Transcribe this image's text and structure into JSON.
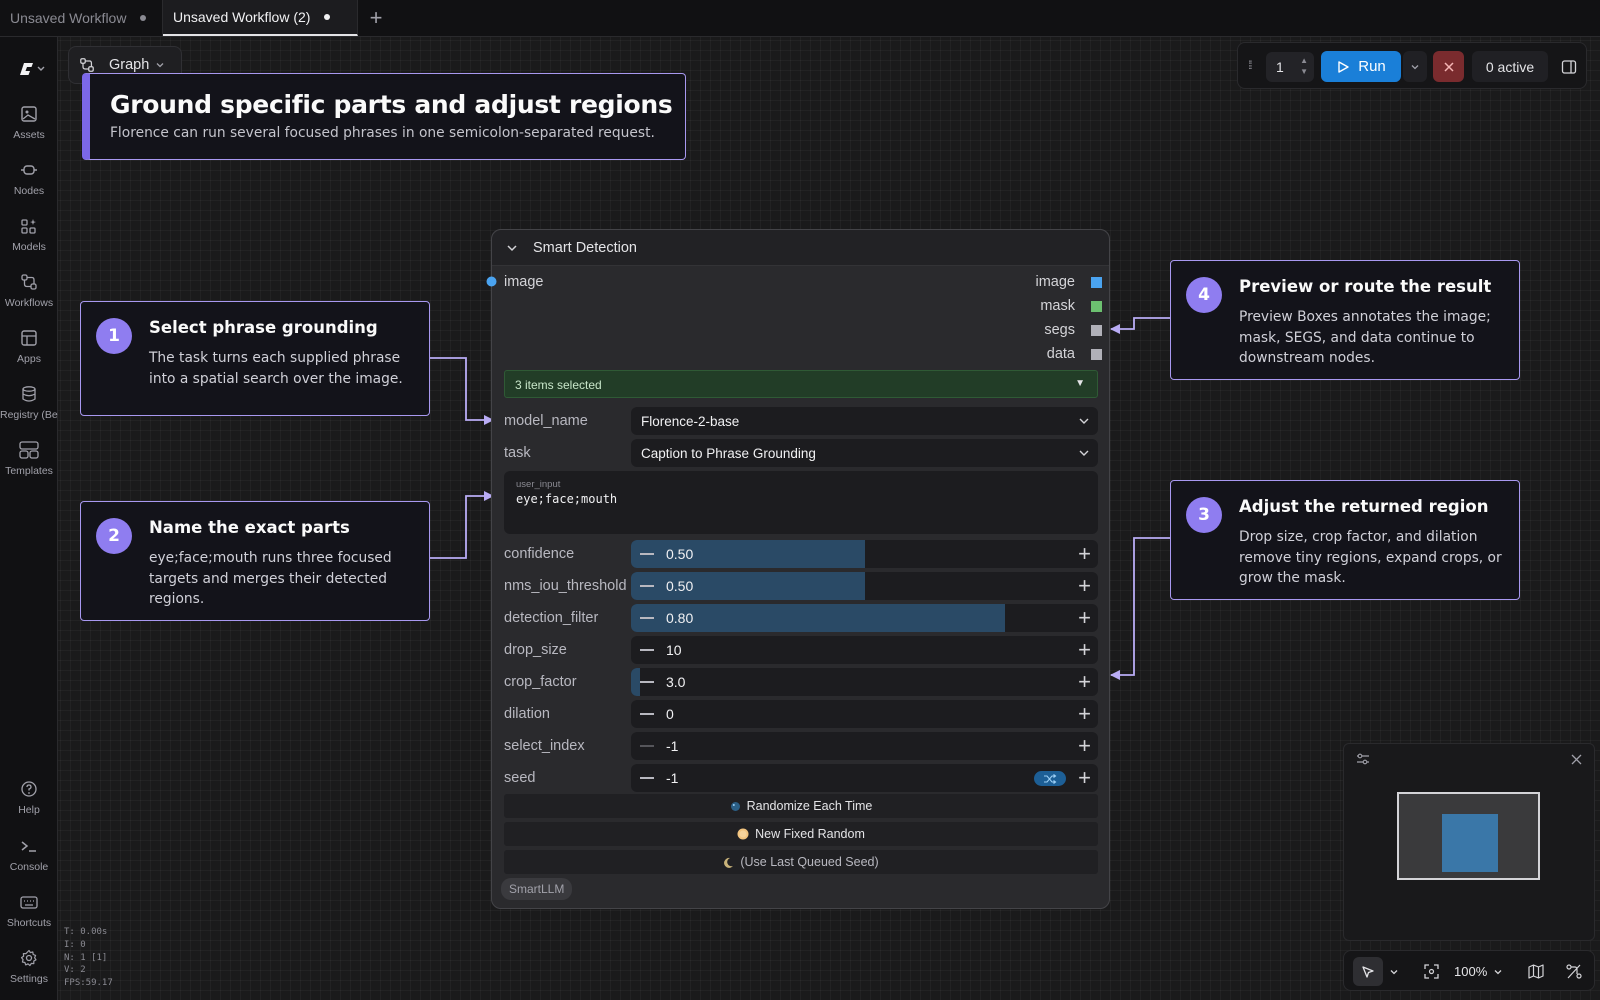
{
  "tabs": [
    {
      "label": "Unsaved Workflow",
      "active": false
    },
    {
      "label": "Unsaved Workflow (2)",
      "active": true
    }
  ],
  "sidebar": {
    "items": [
      {
        "label": "Assets",
        "icon": "image-icon"
      },
      {
        "label": "Nodes",
        "icon": "node-icon"
      },
      {
        "label": "Models",
        "icon": "models-icon"
      },
      {
        "label": "Workflows",
        "icon": "workflow-icon"
      },
      {
        "label": "Apps",
        "icon": "apps-icon"
      },
      {
        "label": "Registry (Beta)",
        "icon": "database-icon"
      },
      {
        "label": "Templates",
        "icon": "templates-icon"
      }
    ],
    "bottom_items": [
      {
        "label": "Help",
        "icon": "help-icon"
      },
      {
        "label": "Console",
        "icon": "terminal-icon"
      },
      {
        "label": "Shortcuts",
        "icon": "keyboard-icon"
      },
      {
        "label": "Settings",
        "icon": "gear-icon"
      }
    ]
  },
  "stats": [
    "T: 0.00s",
    "I: 0",
    "N: 1 [1]",
    "V: 2",
    "FPS:59.17"
  ],
  "graph_button": {
    "label": "Graph"
  },
  "runbar": {
    "count": "1",
    "run_label": "Run",
    "active_label": "0 active",
    "run_color": "#1a7fd8",
    "stop_color": "#7a2b2e"
  },
  "title_card": {
    "title": "Ground specific parts and adjust regions",
    "subtitle": "Florence can run several focused phrases in one semicolon-separated request."
  },
  "steps": [
    {
      "number": "1",
      "title": "Select phrase grounding",
      "body": "The task turns each supplied phrase into a spatial search over the image."
    },
    {
      "number": "2",
      "title": "Name the exact parts",
      "body": "eye;face;mouth runs three focused targets and merges their detected regions."
    },
    {
      "number": "3",
      "title": "Adjust the returned region",
      "body": "Drop size, crop factor, and dilation remove tiny regions, expand crops, or grow the mask."
    },
    {
      "number": "4",
      "title": "Preview or route the result",
      "body": "Preview Boxes annotates the image; mask, SEGS, and data continue to downstream nodes."
    }
  ],
  "node": {
    "title": "Smart Detection",
    "input": "image",
    "outputs": [
      {
        "label": "image",
        "color": "#4aa3f0"
      },
      {
        "label": "mask",
        "color": "#6cc070"
      },
      {
        "label": "segs",
        "color": "#b0b0b8"
      },
      {
        "label": "data",
        "color": "#b0b0b8"
      }
    ],
    "multiselect": "3 items selected",
    "model_name": {
      "label": "model_name",
      "value": "Florence-2-base"
    },
    "task": {
      "label": "task",
      "value": "Caption to Phrase Grounding"
    },
    "user_input": {
      "label": "user_input",
      "value": "eye;face;mouth"
    },
    "widgets": [
      {
        "label": "confidence",
        "value": "0.50",
        "fill": 0.5
      },
      {
        "label": "nms_iou_threshold",
        "value": "0.50",
        "fill": 0.5
      },
      {
        "label": "detection_filter",
        "value": "0.80",
        "fill": 0.8
      },
      {
        "label": "drop_size",
        "value": "10",
        "fill": 0
      },
      {
        "label": "crop_factor",
        "value": "3.0",
        "fill": 0.02
      },
      {
        "label": "dilation",
        "value": "0",
        "fill": 0
      },
      {
        "label": "select_index",
        "value": "-1",
        "fill": 0
      },
      {
        "label": "seed",
        "value": "-1",
        "fill": 0
      }
    ],
    "buttons": [
      "Randomize Each Time",
      "New Fixed Random",
      "(Use Last Queued Seed)"
    ],
    "badge": "SmartLLM"
  },
  "zoom": {
    "label": "100%"
  }
}
